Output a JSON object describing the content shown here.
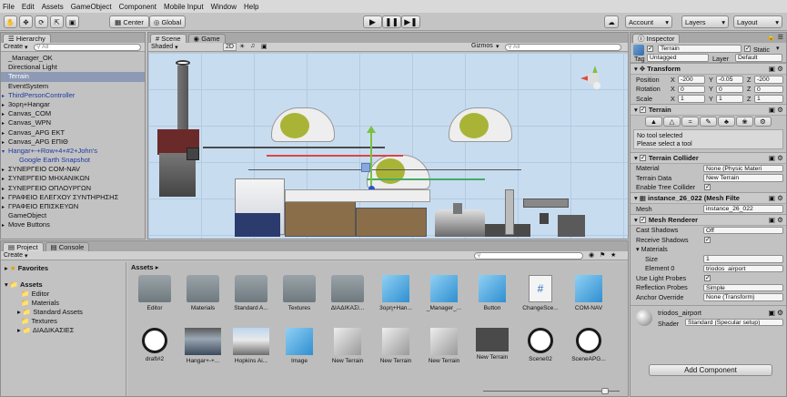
{
  "menu": [
    "File",
    "Edit",
    "Assets",
    "GameObject",
    "Component",
    "Mobile Input",
    "Window",
    "Help"
  ],
  "toolbar": {
    "pivot": "Center",
    "space": "Global",
    "account": "Account",
    "layers": "Layers",
    "layout": "Layout"
  },
  "hierarchy": {
    "tab": "Hierarchy",
    "create": "Create",
    "search_placeholder": "All",
    "items": [
      {
        "label": "_Manager_OK",
        "style": "plain"
      },
      {
        "label": "Directional Light",
        "style": "plain"
      },
      {
        "label": "Terrain",
        "style": "sel"
      },
      {
        "label": "EventSystem",
        "style": "plain"
      },
      {
        "label": "ThirdPersonController",
        "style": "blue"
      },
      {
        "label": "3ορη+Hangar",
        "style": "plain"
      },
      {
        "label": "Canvas_COM",
        "style": "plain"
      },
      {
        "label": "Canvas_WPN",
        "style": "plain"
      },
      {
        "label": "Canvas_APG EKT",
        "style": "plain"
      },
      {
        "label": "Canvas_APG ΕΠΙΘ",
        "style": "plain"
      },
      {
        "label": "Hangar+-+Row+4+#2+John's",
        "style": "blue"
      },
      {
        "label": "Google Earth Snapshot",
        "style": "blue-child"
      },
      {
        "label": "ΣΥΝΕΡΓΕΙΟ COM-NAV",
        "style": "plain"
      },
      {
        "label": "ΣΥΝΕΡΓΕΙΟ ΜΗΧΑΝΙΚΩΝ",
        "style": "plain"
      },
      {
        "label": "ΣΥΝΕΡΓΕΙΟ ΟΠΛΟΥΡΓΩΝ",
        "style": "plain"
      },
      {
        "label": "ΓΡΑΦΕΙΟ ΕΛΕΓΧΟΥ ΣΥΝΤΗΡΗΣΗΣ",
        "style": "plain"
      },
      {
        "label": "ΓΡΑΦΕΙΟ ΕΠΙΣΚΕΥΩΝ",
        "style": "plain"
      },
      {
        "label": "GameObject",
        "style": "plain"
      },
      {
        "label": "Move Buttons",
        "style": "plain"
      }
    ]
  },
  "scene": {
    "tab_scene": "Scene",
    "tab_game": "Game",
    "shaded": "Shaded",
    "mode_2d": "2D",
    "gizmos": "Gizmos",
    "search_placeholder": "All"
  },
  "project": {
    "tab_project": "Project",
    "tab_console": "Console",
    "create": "Create",
    "favorites": "Favorites",
    "tree_assets": "Assets",
    "tree": [
      "Editor",
      "Materials",
      "Standard Assets",
      "Textures",
      "ΔΙΑΔΙΚΑΣΙΕΣ"
    ],
    "breadcrumb": "Assets",
    "row1": [
      {
        "label": "Editor",
        "kind": "folder"
      },
      {
        "label": "Materials",
        "kind": "folder"
      },
      {
        "label": "Standard A...",
        "kind": "folder"
      },
      {
        "label": "Textures",
        "kind": "folder"
      },
      {
        "label": "ΔΙΑΔΙΚΑΣΙ...",
        "kind": "folder"
      },
      {
        "label": "3ορη+Han...",
        "kind": "cube"
      },
      {
        "label": "_Manager_...",
        "kind": "cube"
      },
      {
        "label": "Button",
        "kind": "cube"
      },
      {
        "label": "ChangeSce...",
        "kind": "script"
      },
      {
        "label": "COM-NAV",
        "kind": "cube"
      }
    ],
    "row2": [
      {
        "label": "draft#2",
        "kind": "unity"
      },
      {
        "label": "Hangar+-+...",
        "kind": "photo"
      },
      {
        "label": "Hopkins Ai...",
        "kind": "photo2"
      },
      {
        "label": "Image",
        "kind": "cube"
      },
      {
        "label": "New Terrain",
        "kind": "ucube"
      },
      {
        "label": "New Terrain",
        "kind": "ucube"
      },
      {
        "label": "New Terrain",
        "kind": "ucube"
      },
      {
        "label": "New Terrain",
        "kind": "dark"
      },
      {
        "label": "Scene02",
        "kind": "unity"
      },
      {
        "label": "SceneAPG...",
        "kind": "unity"
      }
    ]
  },
  "inspector": {
    "tab": "Inspector",
    "object_name": "Terrain",
    "static_label": "Static",
    "tag_label": "Tag",
    "tag_value": "Untagged",
    "layer_label": "Layer",
    "layer_value": "Default",
    "transform": {
      "title": "Transform",
      "position_label": "Position",
      "px": "-200",
      "py": "-0.05",
      "pz": "-200",
      "rotation_label": "Rotation",
      "rx": "0",
      "ry": "0",
      "rz": "0",
      "scale_label": "Scale",
      "sx": "1",
      "sy": "1",
      "sz": "1"
    },
    "terrain": {
      "title": "Terrain",
      "msg1": "No tool selected",
      "msg2": "Please select a tool"
    },
    "collider": {
      "title": "Terrain Collider",
      "material_label": "Material",
      "material_value": "None (Physic Materi",
      "data_label": "Terrain Data",
      "data_value": "New Terrain",
      "tree_label": "Enable Tree Collider"
    },
    "mesh_filter": {
      "title": "instance_26_022 (Mesh Filte",
      "mesh_label": "Mesh",
      "mesh_value": "instance_26_022"
    },
    "mesh_renderer": {
      "title": "Mesh Renderer",
      "cast_label": "Cast Shadows",
      "cast_value": "Off",
      "receive_label": "Receive Shadows",
      "materials_label": "Materials",
      "size_label": "Size",
      "size_value": "1",
      "element_label": "Element 0",
      "element_value": "triodos_airport",
      "light_label": "Use Light Probes",
      "reflection_label": "Reflection Probes",
      "reflection_value": "Simple",
      "anchor_label": "Anchor Override",
      "anchor_value": "None (Transform)"
    },
    "material": {
      "name": "triodos_airport",
      "shader_label": "Shader",
      "shader_value": "Standard (Specular setup)"
    },
    "add_component": "Add Component"
  },
  "colors": {
    "accent_sel": "#8d9ab5",
    "blue_text": "#1d3aa0"
  }
}
